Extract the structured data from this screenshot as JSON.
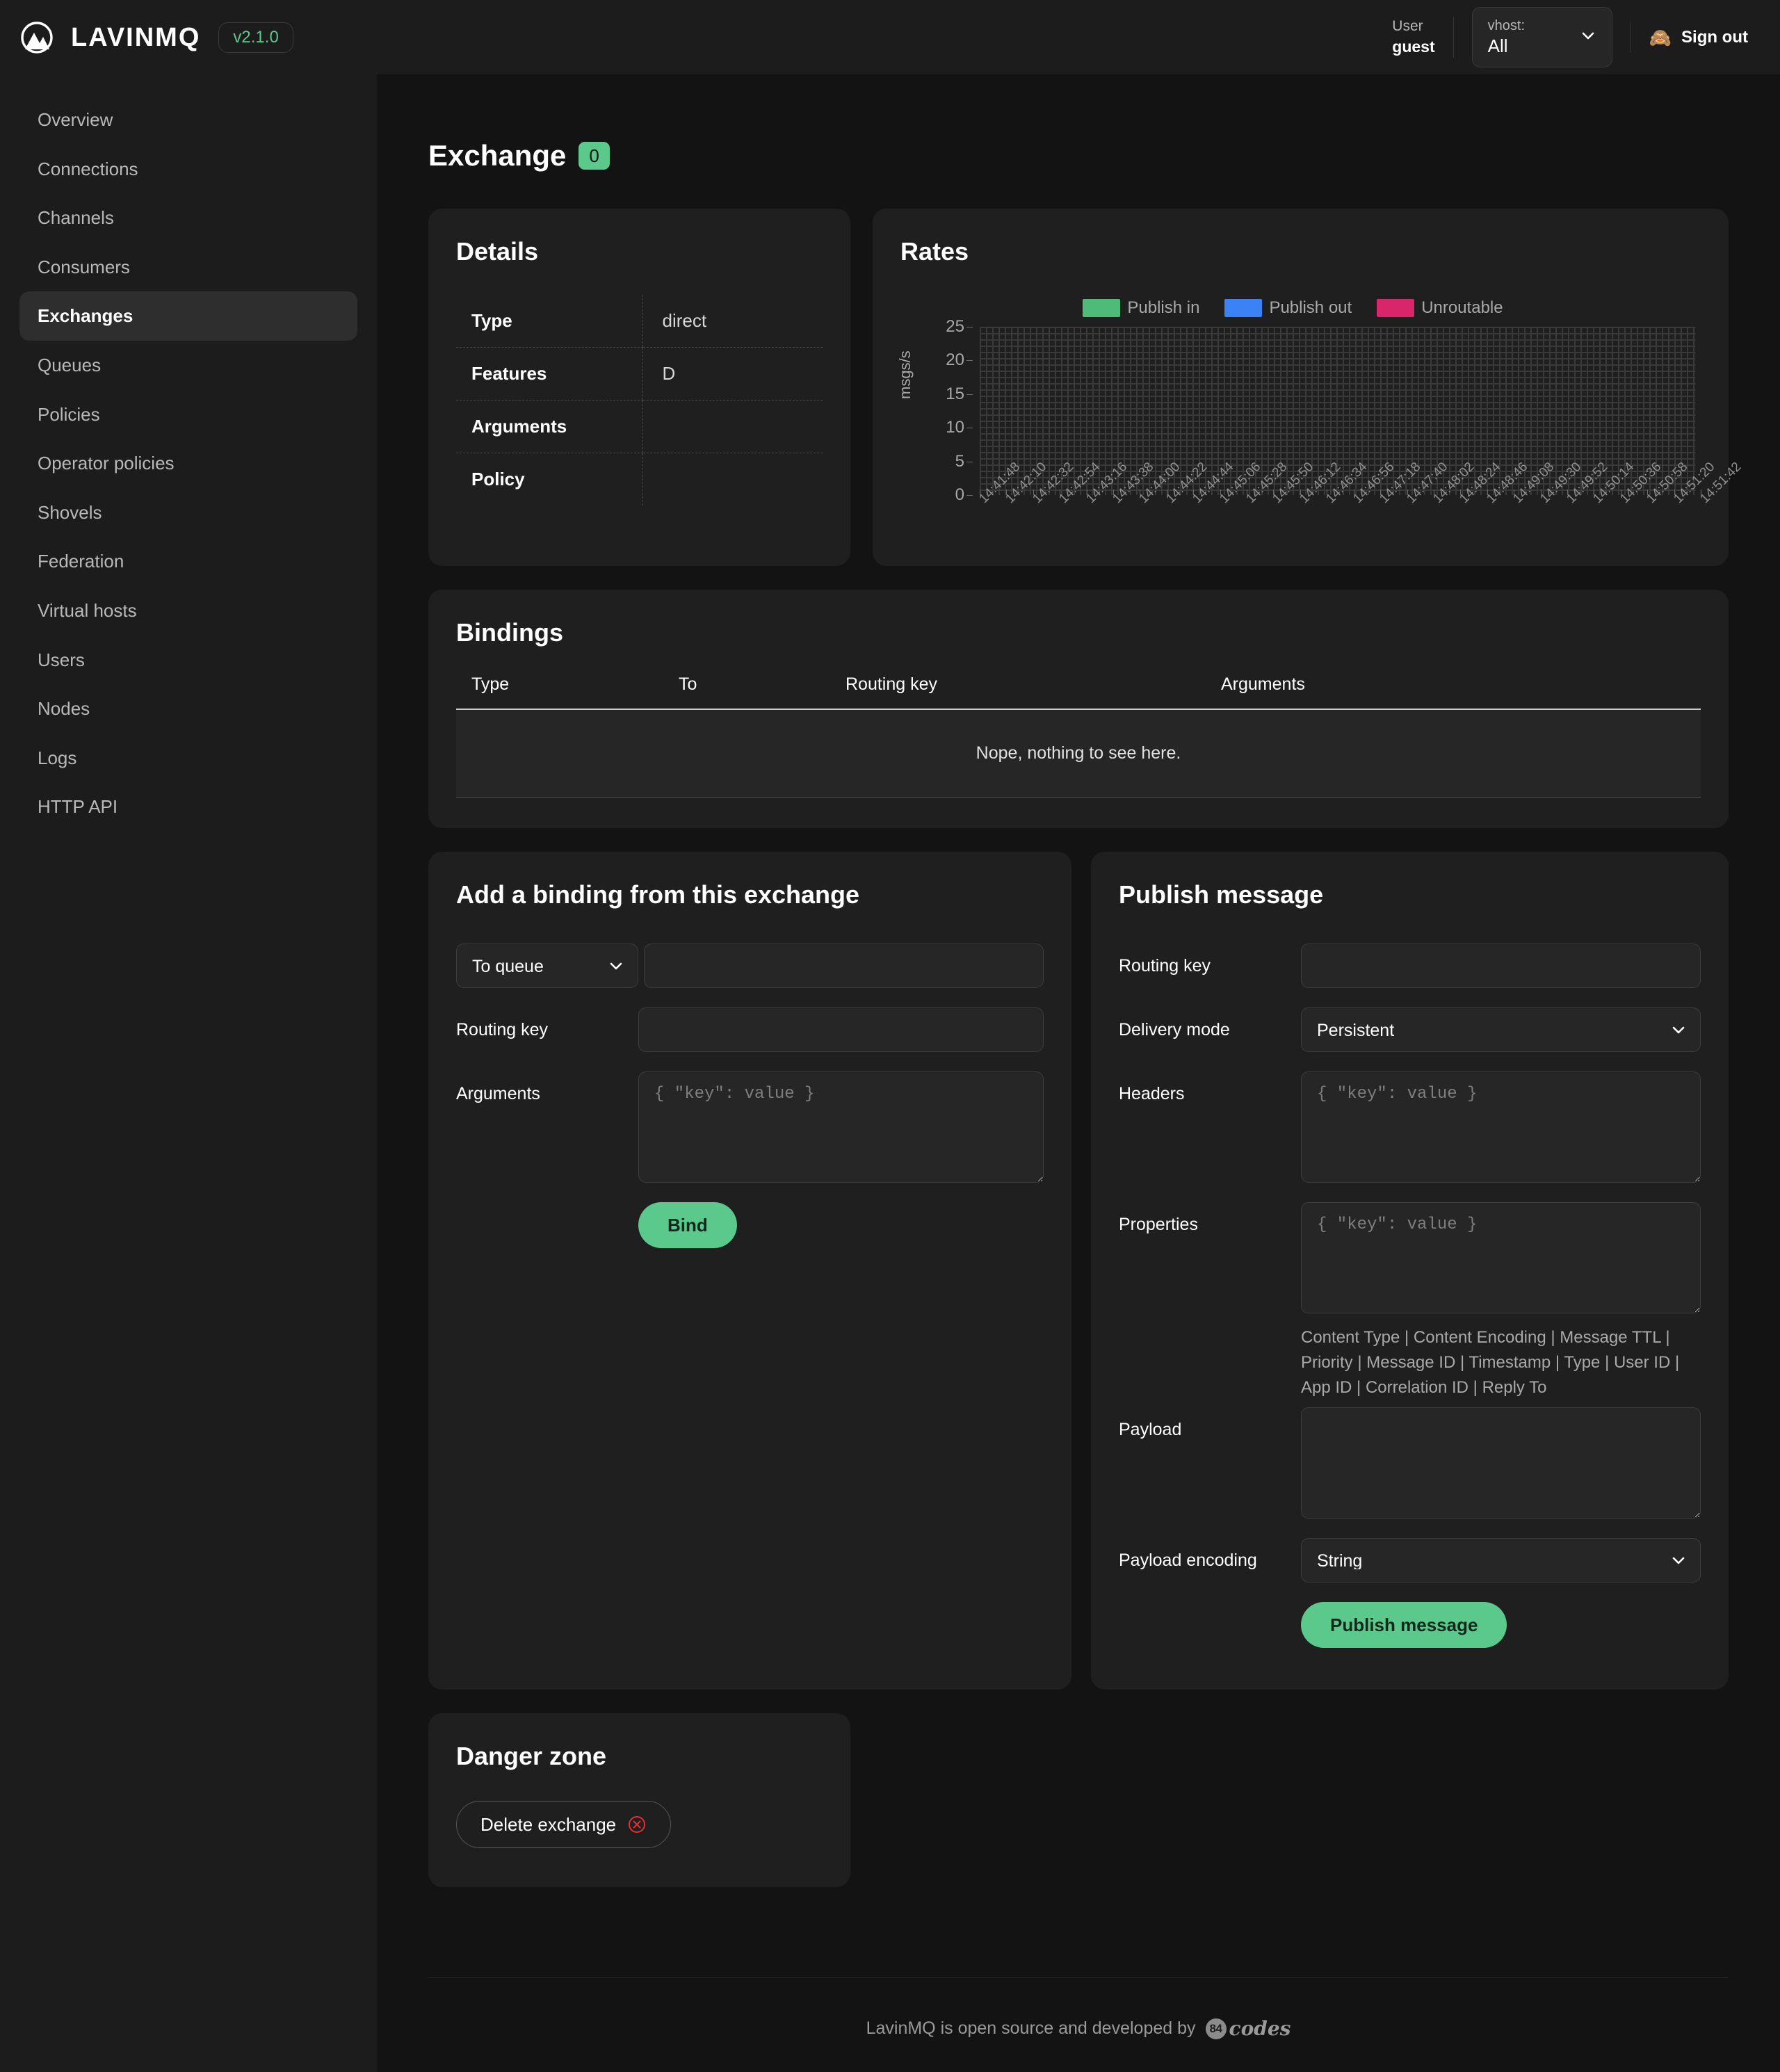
{
  "header": {
    "brand": "LAVINMQ",
    "version": "v2.1.0",
    "user_label": "User",
    "user_name": "guest",
    "vhost_label": "vhost:",
    "vhost_value": "All",
    "signout_label": "Sign out",
    "signout_icon": "monkey-emoji"
  },
  "sidebar": {
    "items": [
      {
        "label": "Overview",
        "active": false
      },
      {
        "label": "Connections",
        "active": false
      },
      {
        "label": "Channels",
        "active": false
      },
      {
        "label": "Consumers",
        "active": false
      },
      {
        "label": "Exchanges",
        "active": true
      },
      {
        "label": "Queues",
        "active": false
      },
      {
        "label": "Policies",
        "active": false
      },
      {
        "label": "Operator policies",
        "active": false
      },
      {
        "label": "Shovels",
        "active": false
      },
      {
        "label": "Federation",
        "active": false
      },
      {
        "label": "Virtual hosts",
        "active": false
      },
      {
        "label": "Users",
        "active": false
      },
      {
        "label": "Nodes",
        "active": false
      },
      {
        "label": "Logs",
        "active": false
      },
      {
        "label": "HTTP API",
        "active": false
      }
    ]
  },
  "page": {
    "title": "Exchange",
    "count_badge": "0"
  },
  "details": {
    "title": "Details",
    "rows": [
      {
        "key": "Type",
        "value": "direct"
      },
      {
        "key": "Features",
        "value": "D"
      },
      {
        "key": "Arguments",
        "value": ""
      },
      {
        "key": "Policy",
        "value": ""
      }
    ]
  },
  "rates": {
    "title": "Rates"
  },
  "chart_data": {
    "type": "line",
    "title": "Rates",
    "xlabel": "",
    "ylabel": "msgs/s",
    "ylim": [
      0,
      25
    ],
    "yticks": [
      0,
      5,
      10,
      15,
      20,
      25
    ],
    "grid": true,
    "legend_position": "top-center",
    "series": [
      {
        "name": "Publish in",
        "color": "#4fbb78",
        "values": []
      },
      {
        "name": "Publish out",
        "color": "#3b82f6",
        "values": []
      },
      {
        "name": "Unroutable",
        "color": "#d9266b",
        "values": []
      }
    ],
    "x": [
      "14:41:48",
      "14:42:10",
      "14:42:32",
      "14:42:54",
      "14:43:16",
      "14:43:38",
      "14:44:00",
      "14:44:22",
      "14:44:44",
      "14:45:06",
      "14:45:28",
      "14:45:50",
      "14:46:12",
      "14:46:34",
      "14:46:56",
      "14:47:18",
      "14:47:40",
      "14:48:02",
      "14:48:24",
      "14:48:46",
      "14:49:08",
      "14:49:30",
      "14:49:52",
      "14:50:14",
      "14:50:36",
      "14:50:58",
      "14:51:20",
      "14:51:42"
    ]
  },
  "bindings": {
    "title": "Bindings",
    "columns": [
      "Type",
      "To",
      "Routing key",
      "Arguments"
    ],
    "rows": [],
    "empty_message": "Nope, nothing to see here."
  },
  "add_binding": {
    "title": "Add a binding from this exchange",
    "destination_select_value": "To queue",
    "destination_input_value": "",
    "destination_input_placeholder": "",
    "routing_key_label": "Routing key",
    "routing_key_value": "",
    "arguments_label": "Arguments",
    "arguments_placeholder": "{ \"key\": value }",
    "arguments_value": "",
    "bind_button": "Bind"
  },
  "publish": {
    "title": "Publish message",
    "routing_key_label": "Routing key",
    "routing_key_value": "",
    "delivery_mode_label": "Delivery mode",
    "delivery_mode_value": "Persistent",
    "headers_label": "Headers",
    "headers_placeholder": "{ \"key\": value }",
    "headers_value": "",
    "properties_label": "Properties",
    "properties_placeholder": "{ \"key\": value }",
    "properties_value": "",
    "properties_hint": "Content Type | Content Encoding | Message TTL | Priority | Message ID | Timestamp | Type | User ID | App ID | Correlation ID | Reply To",
    "payload_label": "Payload",
    "payload_value": "",
    "payload_encoding_label": "Payload encoding",
    "payload_encoding_value": "String",
    "publish_button": "Publish message"
  },
  "danger": {
    "title": "Danger zone",
    "delete_button": "Delete exchange"
  },
  "footer": {
    "text": "LavinMQ is open source and developed by",
    "logo_badge": "84",
    "logo_word": "codes"
  },
  "colors": {
    "accent_green": "#5cc98c",
    "publish_in": "#4fbb78",
    "publish_out": "#3b82f6",
    "unroutable": "#d9266b",
    "danger_red": "#e03131",
    "page_bg": "#131313",
    "card_bg": "#1f1f1f",
    "panel_bg": "#1c1c1c"
  }
}
